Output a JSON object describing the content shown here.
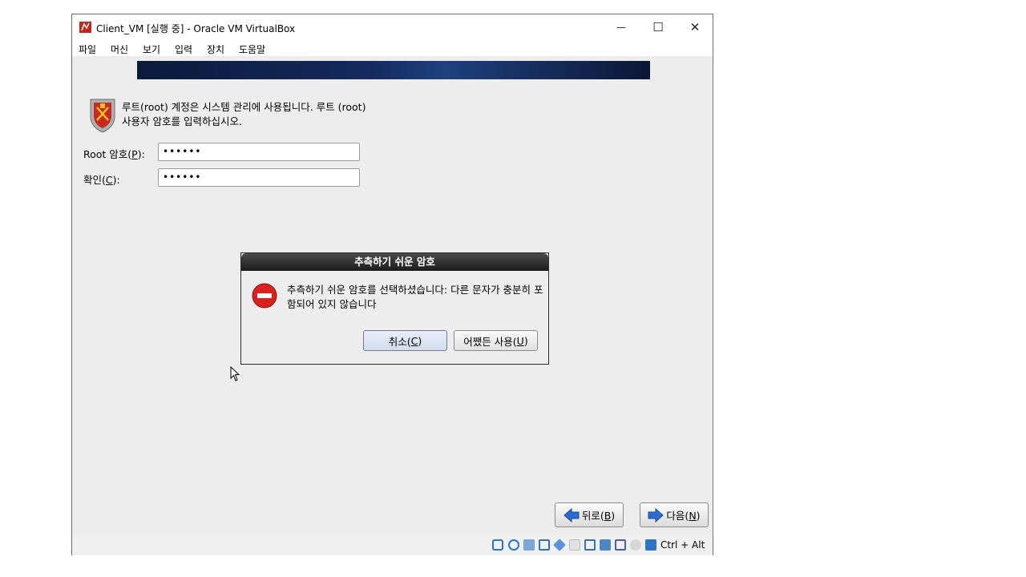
{
  "window": {
    "title": "Client_VM [실행 중] - Oracle VM VirtualBox",
    "controls": {
      "minimize": "—",
      "maximize": "☐",
      "close": "✕"
    }
  },
  "menu": [
    "파일",
    "머신",
    "보기",
    "입력",
    "장치",
    "도움말"
  ],
  "installer": {
    "intro": "루트(root) 계정은 시스템 관리에 사용됩니다. 루트 (root) 사용자 암호를 입력하십시오.",
    "root_label_prefix": "Root 암호(",
    "root_label_mnemonic": "P",
    "root_label_suffix": "):",
    "root_value": "••••••",
    "confirm_label_prefix": "확인(",
    "confirm_label_mnemonic": "C",
    "confirm_label_suffix": "):",
    "confirm_value": "••••••",
    "back_prefix": "뒤로(",
    "back_mnemonic": "B",
    "back_suffix": ")",
    "next_prefix": "다음(",
    "next_mnemonic": "N",
    "next_suffix": ")"
  },
  "dialog": {
    "title": "추측하기 쉬운 암호",
    "message": "추측하기 쉬운 암호를 선택하셨습니다: 다른 문자가 충분히 포함되어 있지 않습니다",
    "cancel_prefix": "취소(",
    "cancel_mnemonic": "C",
    "cancel_suffix": ")",
    "use_prefix": "어쨌든 사용(",
    "use_mnemonic": "U",
    "use_suffix": ")"
  },
  "statusbar": {
    "host_key": "Ctrl + Alt",
    "icons": [
      "hard-disk-icon",
      "optical-drive-icon",
      "audio-icon",
      "network-icon",
      "usb-icon",
      "shared-folders-icon",
      "display-icon",
      "video-capture-icon",
      "virtualization-icon",
      "mouse-integration-icon",
      "keyboard-icon"
    ]
  },
  "colors": {
    "banner": "#142a5e",
    "error_red": "#d9211d",
    "arrow_blue": "#2b6cd4"
  }
}
